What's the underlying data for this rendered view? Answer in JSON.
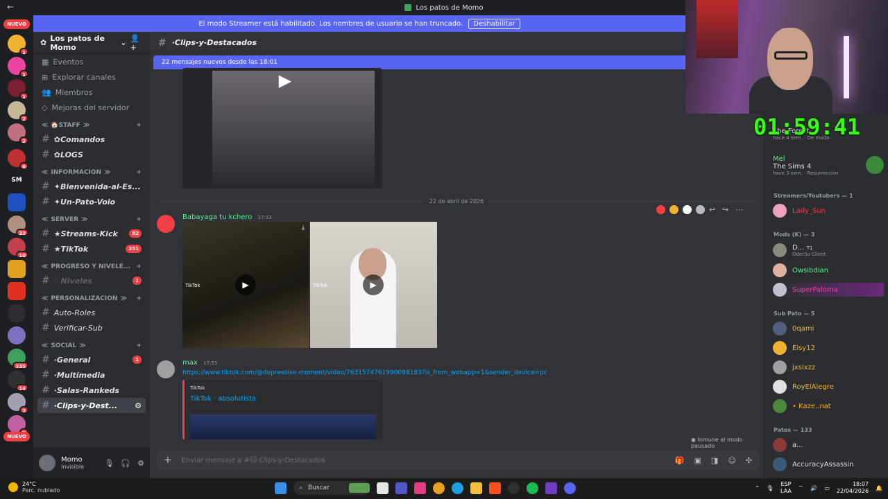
{
  "window": {
    "title": "Los patos de Momo"
  },
  "streamer_banner": {
    "text": "El modo Streamer está habilitado. Los nombres de usuario se han truncado.",
    "button": "Deshabilitar"
  },
  "servers": {
    "nuevo_top": "NUEVO",
    "nuevo_bottom": "NUEVO",
    "sm_label": "SM",
    "badges": [
      "1",
      "1",
      "1",
      "2",
      "2",
      "6",
      "23",
      "10",
      "335",
      "14",
      "3",
      "2"
    ]
  },
  "guild": {
    "name": "Los patos de Momo"
  },
  "nav": {
    "eventos": "Eventos",
    "explorar": "Explorar canales",
    "miembros": "Miembros",
    "mejoras": "Mejoras del servidor"
  },
  "categories": {
    "staff": "🏠STAFF",
    "informacion": "INFORMACION",
    "server": "SERVER",
    "progreso": "PROGRESO Y NIVELE...",
    "personalizacion": "PERSONALIZACION",
    "social": "SOCIAL"
  },
  "channels": {
    "comandos": "✿Comandos",
    "logs": "✿LOGS",
    "bienvenida": "✦Bienvenida-al-Es...",
    "unpato": "✦Un-Pato-Volo",
    "streams": "★Streams-Kick",
    "streams_count": "82",
    "tiktok": "★TikTok",
    "tiktok_count": "251",
    "niveles": "♡Niveles",
    "niveles_count": "1",
    "autoroles": "Auto-Roles",
    "verificar": "Verificar-Sub",
    "general": "·General",
    "general_count": "1",
    "multimedia": "·Multimedia",
    "salas": "·Salas-Rankeds",
    "clips": "·Clips-y-Dest..."
  },
  "user": {
    "name": "Momo",
    "status": "Invisible"
  },
  "channel_header": {
    "name": "·Clips-y-Destacados"
  },
  "new_messages": {
    "text": "22 mensajes nuevos desde las 18:01"
  },
  "date_separator": "22 de abril de 2026",
  "messages": [
    {
      "author": "Babayaga tu kchero",
      "time": "17:53",
      "author_color": "#57f287"
    },
    {
      "author": "max",
      "time": "17:53",
      "author_color": "#57f287",
      "link": "https://www.tiktok.com/@depressive.moment/video/7631574761990098183?is_from_webapp=1&sender_device=pc",
      "embed_provider": "TikTok",
      "embed_title": "TikTok · absolutista"
    }
  ],
  "tiktok_watermark": "TikTok",
  "immune": "Inmune al modo pausado",
  "composer": {
    "placeholder": "Enviar mensaje a #🐱·Clips-y-Destacados"
  },
  "members_panel": {
    "top": [
      {
        "game": "The Forest",
        "meta1": "hace 4 sem.",
        "meta2": "De moda"
      },
      {
        "name": "Mel",
        "game": "The Sims 4",
        "meta1": "hace 3 sem.",
        "meta2": "Resurrección"
      }
    ],
    "sections": {
      "streamers": "Streamers/Youtubers — 1",
      "mods": "Mods (K) — 3",
      "subpato": "Sub Pato — 5",
      "patos": "Patos — 133"
    },
    "streamers": [
      {
        "name": "Lady_Sun",
        "color": "#f23f43"
      }
    ],
    "mods": [
      {
        "name": "D...",
        "badge": "T1",
        "status": "OderSo Client",
        "color": "#dbdee1"
      },
      {
        "name": "Owsibdian",
        "color": "#57f287"
      },
      {
        "name": "SuperPaloma",
        "color": "#eb459e"
      }
    ],
    "subpato": [
      {
        "name": "0qami"
      },
      {
        "name": "Eisy12"
      },
      {
        "name": "jxsixzz"
      },
      {
        "name": "RoyElAlegre"
      },
      {
        "name": "• Kaze..nat"
      }
    ],
    "patos": [
      {
        "name": "a..."
      },
      {
        "name": "AccuracyAssassin"
      }
    ]
  },
  "overlay": {
    "timer": "01:59:41"
  },
  "taskbar": {
    "temp": "24°C",
    "weather": "Parc. nublado",
    "search": "Buscar",
    "lang1": "ESP",
    "lang2": "LAA",
    "time": "18:07",
    "date": "22/04/2026"
  }
}
